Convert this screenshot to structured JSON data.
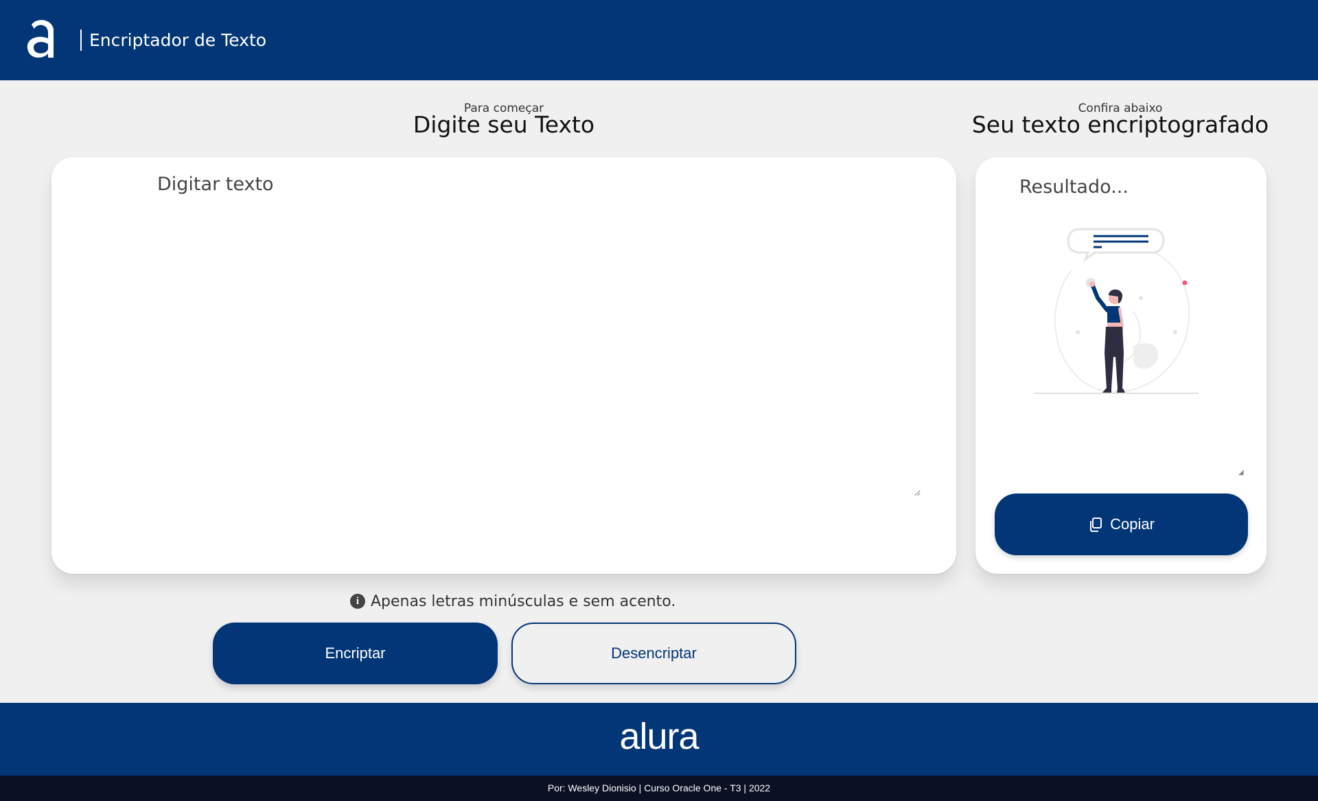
{
  "header": {
    "logo_icon": "alura-a-logo",
    "title": "Encriptador de Texto"
  },
  "input_section": {
    "subtitle": "Para começar",
    "title": "Digite seu Texto",
    "textarea_placeholder": "Digitar texto",
    "info_icon": "info-icon",
    "info_text": "Apenas letras minúsculas e sem acento.",
    "encrypt_label": "Encriptar",
    "decrypt_label": "Desencriptar"
  },
  "output_section": {
    "subtitle": "Confira abaixo",
    "title": "Seu texto encriptografado",
    "result_placeholder": "Resultado...",
    "illustration": "woman-with-speech-bubble",
    "copy_icon": "copy-icon",
    "copy_label": "Copiar"
  },
  "footer": {
    "brand": "alura",
    "credits": "Por: Wesley Dionisio | Curso Oracle One - T3 | 2022"
  },
  "colors": {
    "primary": "#023676",
    "background": "#f0f0f0",
    "card": "#ffffff",
    "credits_bar": "#0b1124",
    "accent_pink": "#f25b7a"
  }
}
